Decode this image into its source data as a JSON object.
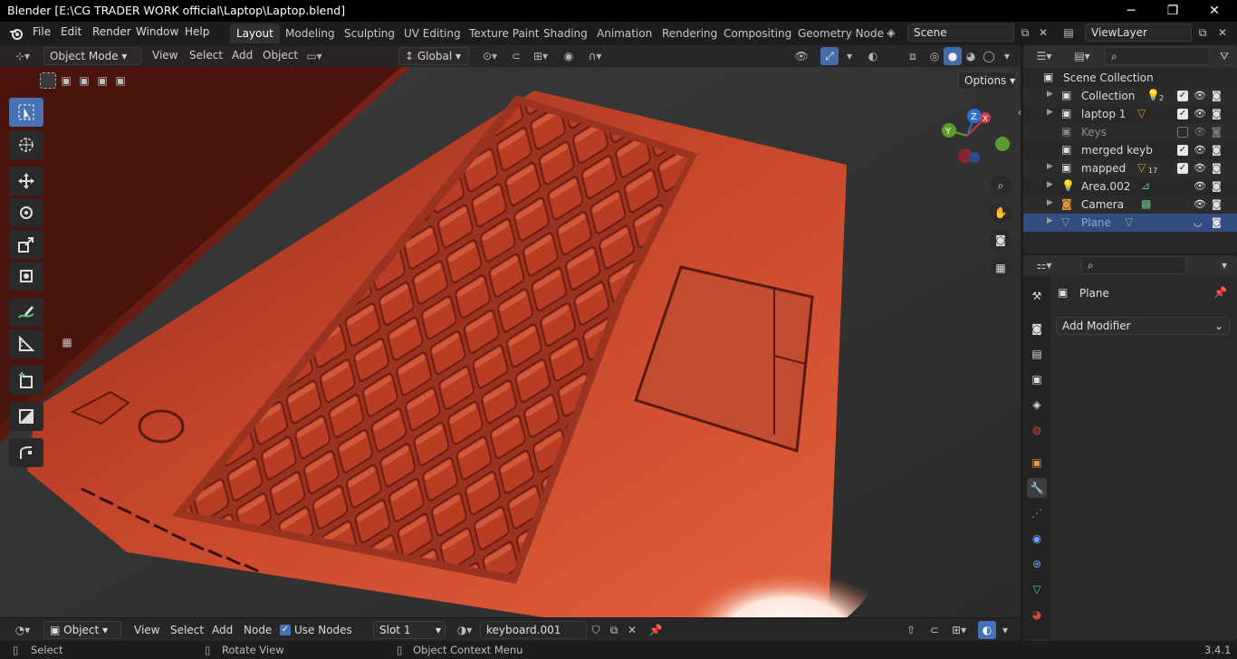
{
  "window": {
    "title": "Blender [E:\\CG TRADER WORK official\\Laptop\\Laptop.blend]",
    "minimize": "─",
    "restore": "❐",
    "close": "✕"
  },
  "menus": [
    "File",
    "Edit",
    "Render",
    "Window",
    "Help"
  ],
  "workspaces": [
    "Layout",
    "Modeling",
    "Sculpting",
    "UV Editing",
    "Texture Paint",
    "Shading",
    "Animation",
    "Rendering",
    "Compositing",
    "Geometry Node"
  ],
  "active_workspace": "Layout",
  "scene": {
    "name": "Scene",
    "view_layer": "ViewLayer"
  },
  "viewport": {
    "mode": "Object Mode",
    "menus": [
      "View",
      "Select",
      "Add",
      "Object"
    ],
    "orientation": "Global",
    "options_label": "Options"
  },
  "gizmo": {
    "x": "X",
    "y": "Y",
    "z": "Z"
  },
  "outliner": {
    "root": "Scene Collection",
    "rows": [
      {
        "name": "Collection",
        "badge": "2",
        "checked": true
      },
      {
        "name": "laptop 1",
        "badge": "",
        "checked": true
      },
      {
        "name": "Keys",
        "badge": "",
        "checked": false
      },
      {
        "name": "merged keyb",
        "badge": "",
        "checked": true
      },
      {
        "name": "mapped",
        "badge": "17",
        "checked": true
      },
      {
        "name": "Area.002",
        "badge": "",
        "checked": null
      },
      {
        "name": "Camera",
        "badge": "",
        "checked": null
      },
      {
        "name": "Plane",
        "badge": "",
        "checked": null
      }
    ]
  },
  "properties": {
    "object_name": "Plane",
    "add_modifier": "Add Modifier"
  },
  "bottom_editor": {
    "mode": "Object",
    "menus": [
      "View",
      "Select",
      "Add",
      "Node"
    ],
    "use_nodes_label": "Use Nodes",
    "slot": "Slot 1",
    "material": "keyboard.001"
  },
  "status": {
    "select": "Select",
    "rotate": "Rotate View",
    "context": "Object Context Menu",
    "version": "3.4.1"
  },
  "colors": {
    "accent": "#4772b3",
    "laptop": "#c6442a",
    "selected_row": "#334d80"
  }
}
